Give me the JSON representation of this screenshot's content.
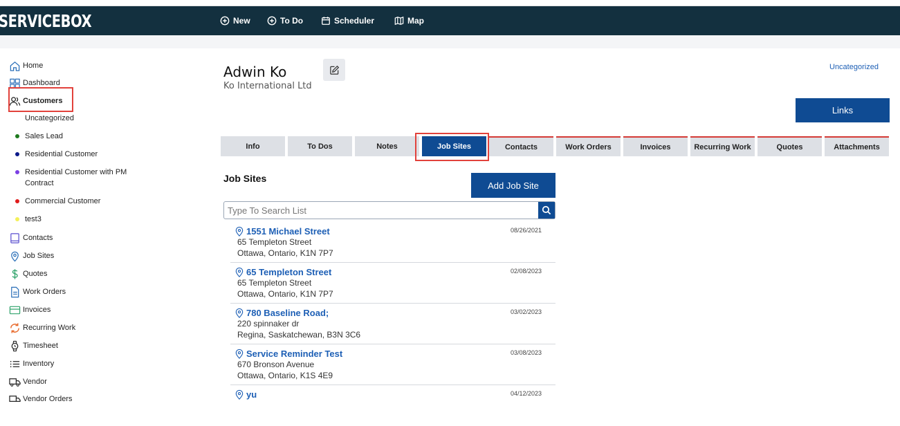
{
  "app": {
    "logo": "SERVICEBOX"
  },
  "nav": {
    "new": "New",
    "todo": "To Do",
    "scheduler": "Scheduler",
    "map": "Map"
  },
  "sidebar": {
    "home": "Home",
    "dashboard": "Dashboard",
    "customers": "Customers",
    "categories": [
      {
        "label": "Uncategorized",
        "color": ""
      },
      {
        "label": "Sales Lead",
        "color": "#1e7a1e"
      },
      {
        "label": "Residential Customer",
        "color": "#0c1a8a"
      },
      {
        "label": "Residential Customer with PM Contract",
        "color": "#7b3fe4"
      },
      {
        "label": "Commercial Customer",
        "color": "#e01b1b"
      },
      {
        "label": "test3",
        "color": "#f4f05a"
      }
    ],
    "contacts": "Contacts",
    "job_sites": "Job Sites",
    "quotes": "Quotes",
    "work_orders": "Work Orders",
    "invoices": "Invoices",
    "recurring_work": "Recurring Work",
    "timesheet": "Timesheet",
    "inventory": "Inventory",
    "vendor": "Vendor",
    "vendor_orders": "Vendor Orders"
  },
  "customer": {
    "name": "Adwin Ko",
    "company": "Ko International Ltd",
    "category": "Uncategorized"
  },
  "links_label": "Links",
  "tabs": [
    "Info",
    "To Dos",
    "Notes",
    "Job Sites",
    "Contacts",
    "Work Orders",
    "Invoices",
    "Recurring Work",
    "Quotes",
    "Attachments"
  ],
  "active_tab": "Job Sites",
  "panel": {
    "title": "Job Sites",
    "add_label": "Add Job Site",
    "search_placeholder": "Type To Search List",
    "sites": [
      {
        "name": "1551 Michael Street",
        "date": "08/26/2021",
        "line1": "65 Templeton Street",
        "line2": "Ottawa, Ontario, K1N 7P7"
      },
      {
        "name": "65 Templeton Street",
        "date": "02/08/2023",
        "line1": "65 Templeton Street",
        "line2": "Ottawa, Ontario, K1N 7P7"
      },
      {
        "name": "780 Baseline Road;",
        "date": "03/02/2023",
        "line1": "220 spinnaker dr",
        "line2": "Regina, Saskatchewan, B3N 3C6"
      },
      {
        "name": "Service Reminder Test",
        "date": "03/08/2023",
        "line1": "670 Bronson Avenue",
        "line2": "Ottawa, Ontario, K1S 4E9"
      },
      {
        "name": "yu",
        "date": "04/12/2023",
        "line1": "",
        "line2": ""
      }
    ]
  },
  "colors": {
    "navbar": "#13303f",
    "primary": "#0f4b93",
    "link": "#1d5fb5",
    "highlight": "#e2413b"
  }
}
